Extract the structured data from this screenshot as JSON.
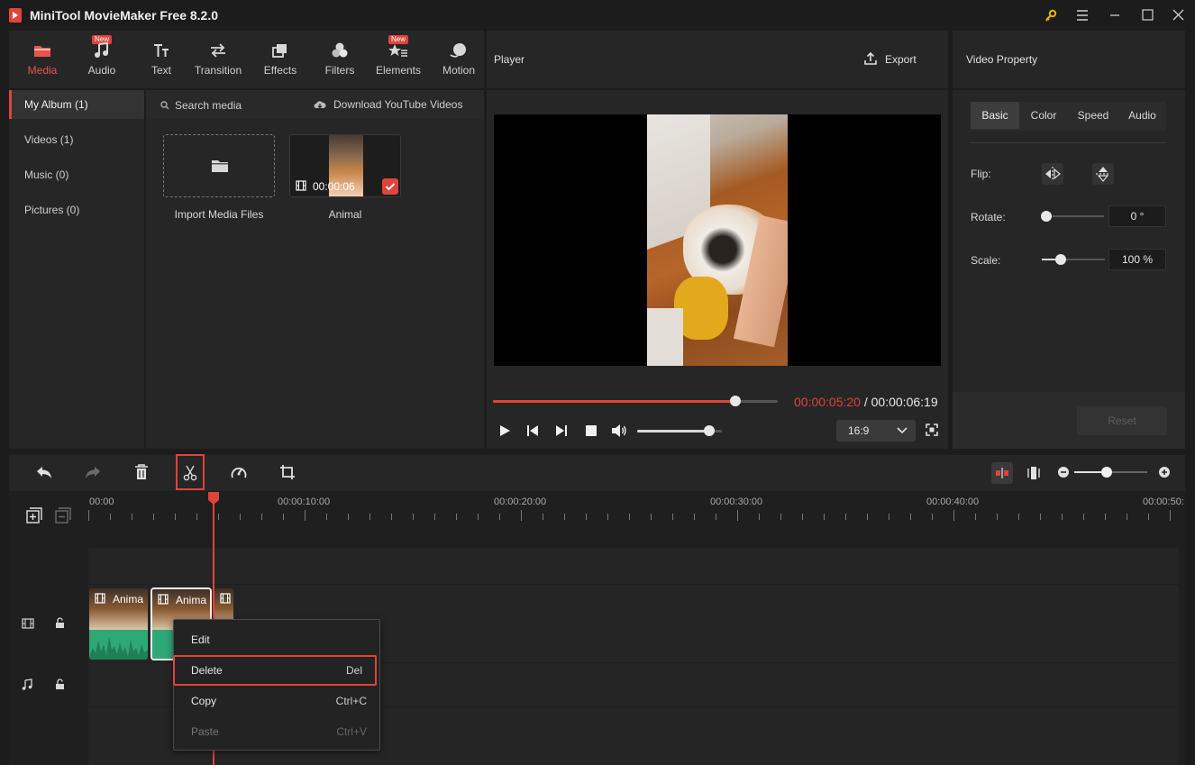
{
  "window": {
    "title": "MiniTool MovieMaker Free 8.2.0"
  },
  "toolbar": {
    "tabs": [
      {
        "label": "Media",
        "icon": "folder-icon",
        "active": true,
        "badge": ""
      },
      {
        "label": "Audio",
        "icon": "music-note-icon",
        "active": false,
        "badge": "New"
      },
      {
        "label": "Text",
        "icon": "text-icon",
        "active": false,
        "badge": ""
      },
      {
        "label": "Transition",
        "icon": "transition-arrows-icon",
        "active": false,
        "badge": ""
      },
      {
        "label": "Effects",
        "icon": "effects-icon",
        "active": false,
        "badge": ""
      },
      {
        "label": "Filters",
        "icon": "filters-icon",
        "active": false,
        "badge": ""
      },
      {
        "label": "Elements",
        "icon": "elements-icon",
        "active": false,
        "badge": "New"
      },
      {
        "label": "Motion",
        "icon": "motion-icon",
        "active": false,
        "badge": ""
      }
    ]
  },
  "sidebar": {
    "items": [
      {
        "label": "My Album (1)",
        "active": true
      },
      {
        "label": "Videos (1)",
        "active": false
      },
      {
        "label": "Music (0)",
        "active": false
      },
      {
        "label": "Pictures (0)",
        "active": false
      }
    ]
  },
  "media": {
    "search_label": "Search media",
    "download_label": "Download YouTube Videos",
    "import_label": "Import Media Files",
    "clip_name": "Animal",
    "clip_duration": "00:00:06"
  },
  "player": {
    "title": "Player",
    "export_label": "Export",
    "current_time": "00:00:05:20",
    "separator": " / ",
    "total_time": "00:00:06:19",
    "progress": 0.85,
    "volume": 0.85,
    "aspect_ratio": "16:9"
  },
  "video_property": {
    "title": "Video Property",
    "tabs": [
      "Basic",
      "Color",
      "Speed",
      "Audio"
    ],
    "active_tab": "Basic",
    "flip_label": "Flip:",
    "rotate_label": "Rotate:",
    "rotate_value": "0 °",
    "rotate_level": 0.0,
    "scale_label": "Scale:",
    "scale_value": "100 %",
    "scale_level": 0.3,
    "reset_label": "Reset"
  },
  "timeline": {
    "ruler_labels": [
      "00:00",
      "00:00:10:00",
      "00:00:20:00",
      "00:00:30:00",
      "00:00:40:00",
      "00:00:50:"
    ],
    "clip_label": "Anima",
    "zoom_level": 0.45
  },
  "context_menu": {
    "items": [
      {
        "label": "Edit",
        "shortcut": "",
        "enabled": true,
        "highlighted": false
      },
      {
        "label": "Delete",
        "shortcut": "Del",
        "enabled": true,
        "highlighted": true
      },
      {
        "label": "Copy",
        "shortcut": "Ctrl+C",
        "enabled": true,
        "highlighted": false
      },
      {
        "label": "Paste",
        "shortcut": "Ctrl+V",
        "enabled": false,
        "highlighted": false
      }
    ]
  },
  "colors": {
    "accent": "#e0433b",
    "panel": "#262626",
    "background": "#1c1c1c",
    "audio_wave": "#2fa877"
  }
}
